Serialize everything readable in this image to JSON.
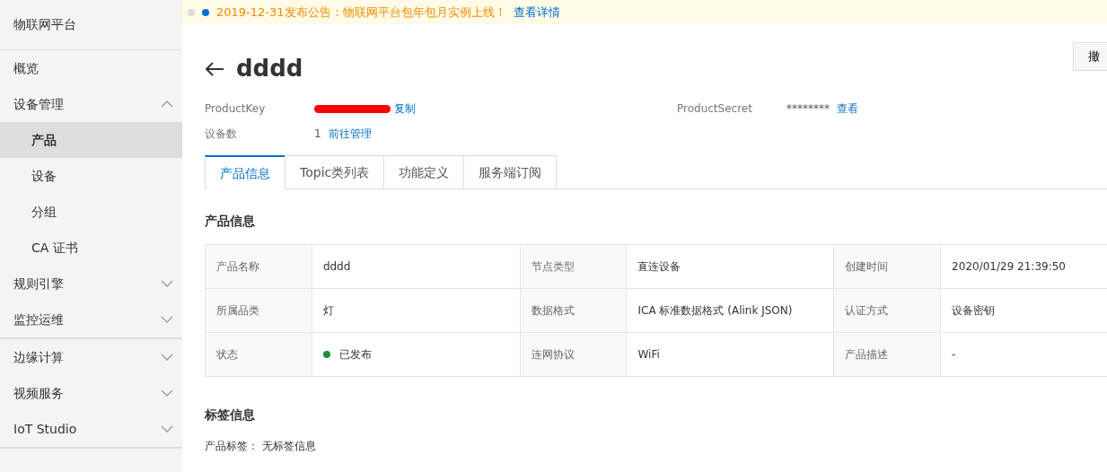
{
  "sidebar": {
    "title": "物联网平台",
    "groups": [
      {
        "items": [
          {
            "label": "概览",
            "selected": false
          },
          {
            "label": "设备管理",
            "expanded": true,
            "children": [
              {
                "label": "产品",
                "selected": true
              },
              {
                "label": "设备",
                "selected": false
              },
              {
                "label": "分组",
                "selected": false
              },
              {
                "label": "CA 证书",
                "selected": false
              }
            ]
          },
          {
            "label": "规则引擎",
            "expanded": false
          },
          {
            "label": "监控运维",
            "expanded": false
          }
        ]
      },
      {
        "items": [
          {
            "label": "边缘计算",
            "expanded": false
          },
          {
            "label": "视频服务",
            "expanded": false
          },
          {
            "label": "IoT Studio",
            "expanded": false
          }
        ]
      }
    ]
  },
  "notice": {
    "text": "2019-12-31发布公告：物联网平台包年包月实例上线！",
    "link": "查看详情"
  },
  "header": {
    "title": "dddd",
    "button": "撤"
  },
  "meta": [
    {
      "label": "ProductKey",
      "redacted": true,
      "link": "复制"
    },
    {
      "label": "ProductSecret",
      "value": "********",
      "link": "查看"
    },
    {
      "label": "设备数",
      "value": "1",
      "link": "前往管理"
    }
  ],
  "tabs": [
    {
      "label": "产品信息",
      "selected": true
    },
    {
      "label": "Topic类列表",
      "selected": false
    },
    {
      "label": "功能定义",
      "selected": false
    },
    {
      "label": "服务端订阅",
      "selected": false
    }
  ],
  "product_info": {
    "title": "产品信息",
    "rows": [
      [
        {
          "label": "产品名称",
          "value": "dddd"
        },
        {
          "label": "节点类型",
          "value": "直连设备"
        },
        {
          "label": "创建时间",
          "value": "2020/01/29 21:39:50"
        }
      ],
      [
        {
          "label": "所属品类",
          "value": "灯"
        },
        {
          "label": "数据格式",
          "value": "ICA 标准数据格式 (Alink JSON)"
        },
        {
          "label": "认证方式",
          "value": "设备密钥"
        }
      ],
      [
        {
          "label": "状态",
          "value": "已发布",
          "color": "#1e8e3e"
        },
        {
          "label": "连网协议",
          "value": "WiFi"
        },
        {
          "label": "产品描述",
          "value": "-"
        }
      ]
    ]
  },
  "tags": {
    "title": "标签信息",
    "label": "产品标签：",
    "value": "无标签信息"
  }
}
